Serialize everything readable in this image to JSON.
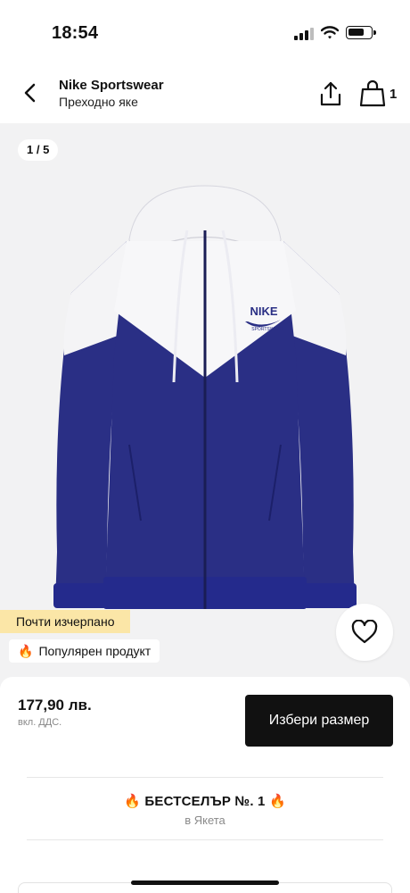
{
  "status": {
    "time": "18:54"
  },
  "header": {
    "brand": "Nike Sportswear",
    "subtitle": "Преходно яке",
    "bag_count": "1"
  },
  "gallery": {
    "counter": "1 / 5",
    "product_logo": "NIKE",
    "product_logo_sub": "SPORTSWEAR"
  },
  "badges": {
    "low_stock": "Почти изчерпано",
    "popular": "Популярен продукт",
    "popular_icon": "🔥"
  },
  "purchase": {
    "price": "177,90 лв.",
    "vat_note": "вкл. ДДС.",
    "select_size": "Избери размер"
  },
  "bestseller": {
    "icon": "🔥",
    "title": "БЕСТСЕЛЪР №. 1",
    "category": "в Якета"
  },
  "colors": {
    "jacket_blue": "#2a2f85",
    "jacket_white": "#f7f7f9",
    "low_stock_badge": "#fbe6a7",
    "button_dark": "#111111"
  }
}
